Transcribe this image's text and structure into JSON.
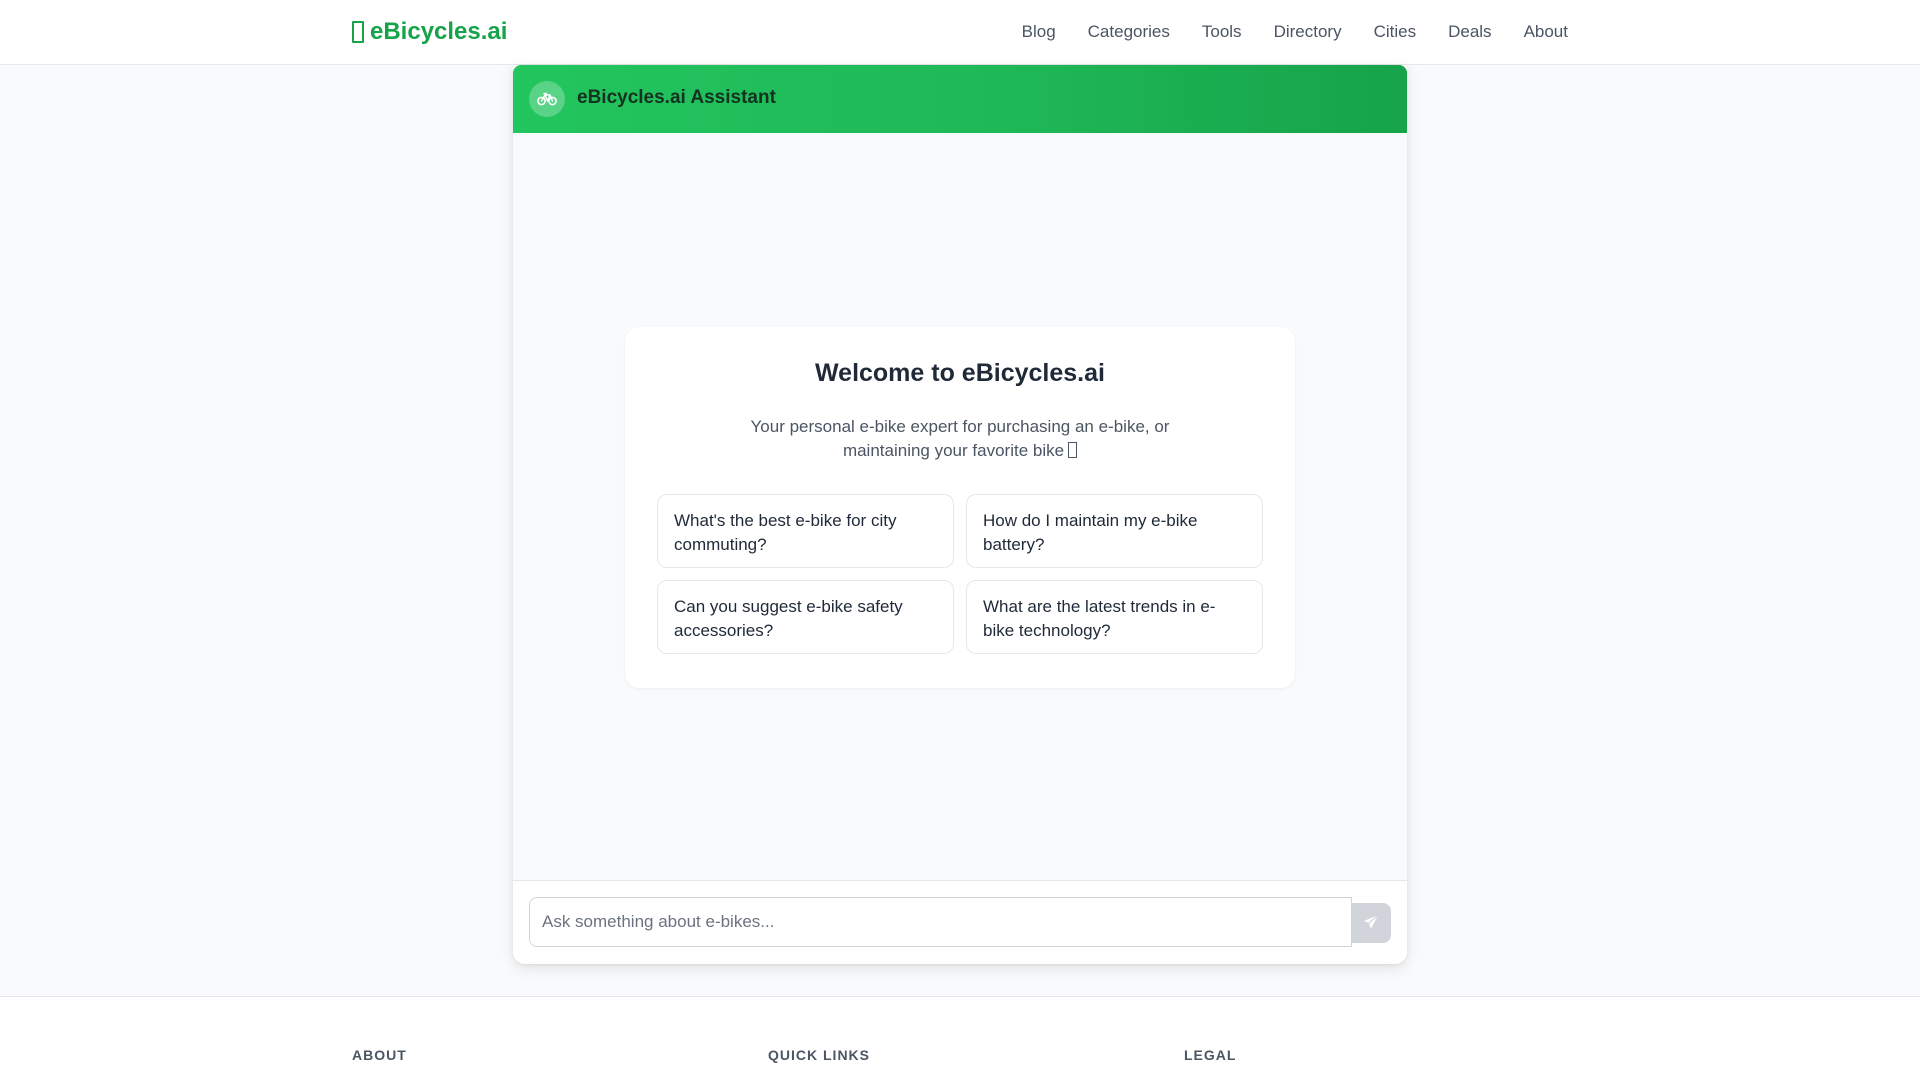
{
  "brand": {
    "name": "eBicycles.ai",
    "color": "#16a34a"
  },
  "nav": {
    "items": [
      {
        "label": "Blog"
      },
      {
        "label": "Categories"
      },
      {
        "label": "Tools"
      },
      {
        "label": "Directory"
      },
      {
        "label": "Cities"
      },
      {
        "label": "Deals"
      },
      {
        "label": "About"
      }
    ]
  },
  "chat": {
    "title": "eBicycles.ai Assistant",
    "avatar_icon": "bicycle-icon",
    "welcome": {
      "title": "Welcome to eBicycles.ai",
      "subtitle": "Your personal e-bike expert for purchasing an e-bike, or maintaining your favorite bike"
    },
    "suggestions": [
      {
        "text": "What's the best e-bike for city commuting?"
      },
      {
        "text": "How do I maintain my e-bike battery?"
      },
      {
        "text": "Can you suggest e-bike safety accessories?"
      },
      {
        "text": "What are the latest trends in e-bike technology?"
      }
    ],
    "input": {
      "placeholder": "Ask something about e-bikes...",
      "value": ""
    },
    "send_icon": "paper-plane-icon"
  },
  "footer": {
    "columns": [
      {
        "title": "ABOUT"
      },
      {
        "title": "QUICK LINKS"
      },
      {
        "title": "LEGAL"
      }
    ]
  },
  "colors": {
    "accent": "#22c55e",
    "accent_dark": "#16a34a",
    "background": "#f8fafc"
  }
}
